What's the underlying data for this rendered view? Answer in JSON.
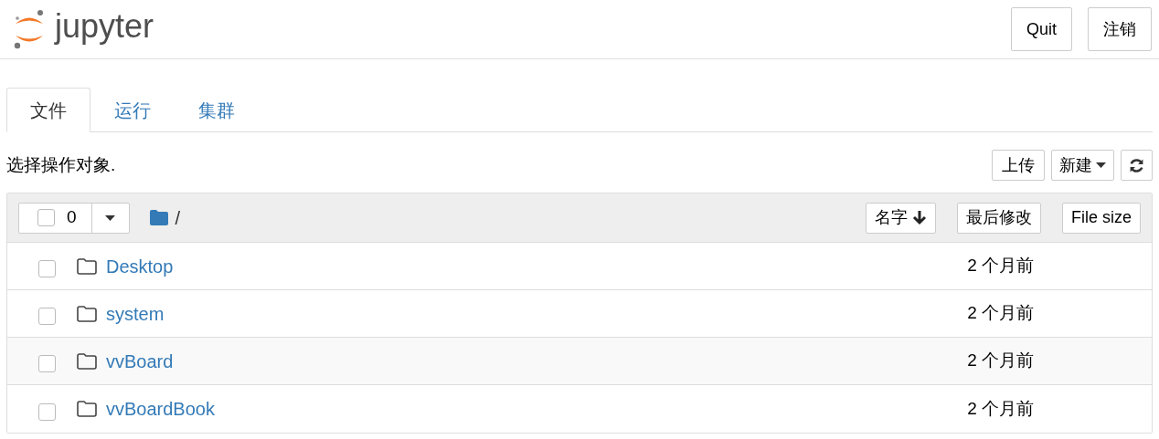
{
  "header": {
    "logo_text": "jupyter",
    "buttons": [
      "Quit",
      "注销"
    ]
  },
  "tabs": [
    {
      "label": "文件",
      "selected": true
    },
    {
      "label": "运行",
      "selected": false
    },
    {
      "label": "集群",
      "selected": false
    }
  ],
  "toolbar": {
    "hint": "选择操作对象.",
    "upload": "上传",
    "new": "新建"
  },
  "list_header": {
    "select_all_checked": false,
    "count": "0",
    "path": "/",
    "sort_buttons": [
      {
        "label": "名字",
        "sorted": true
      },
      {
        "label": "最后修改",
        "sorted": false
      },
      {
        "label": "File size",
        "sorted": false
      }
    ]
  },
  "rows": [
    {
      "name": "Desktop",
      "modified": "2 个月前",
      "checked": false
    },
    {
      "name": "system",
      "modified": "2 个月前",
      "checked": false
    },
    {
      "name": "vvBoard",
      "modified": "2 个月前",
      "checked": false
    },
    {
      "name": "vvBoardBook",
      "modified": "2 个月前",
      "checked": false
    }
  ]
}
